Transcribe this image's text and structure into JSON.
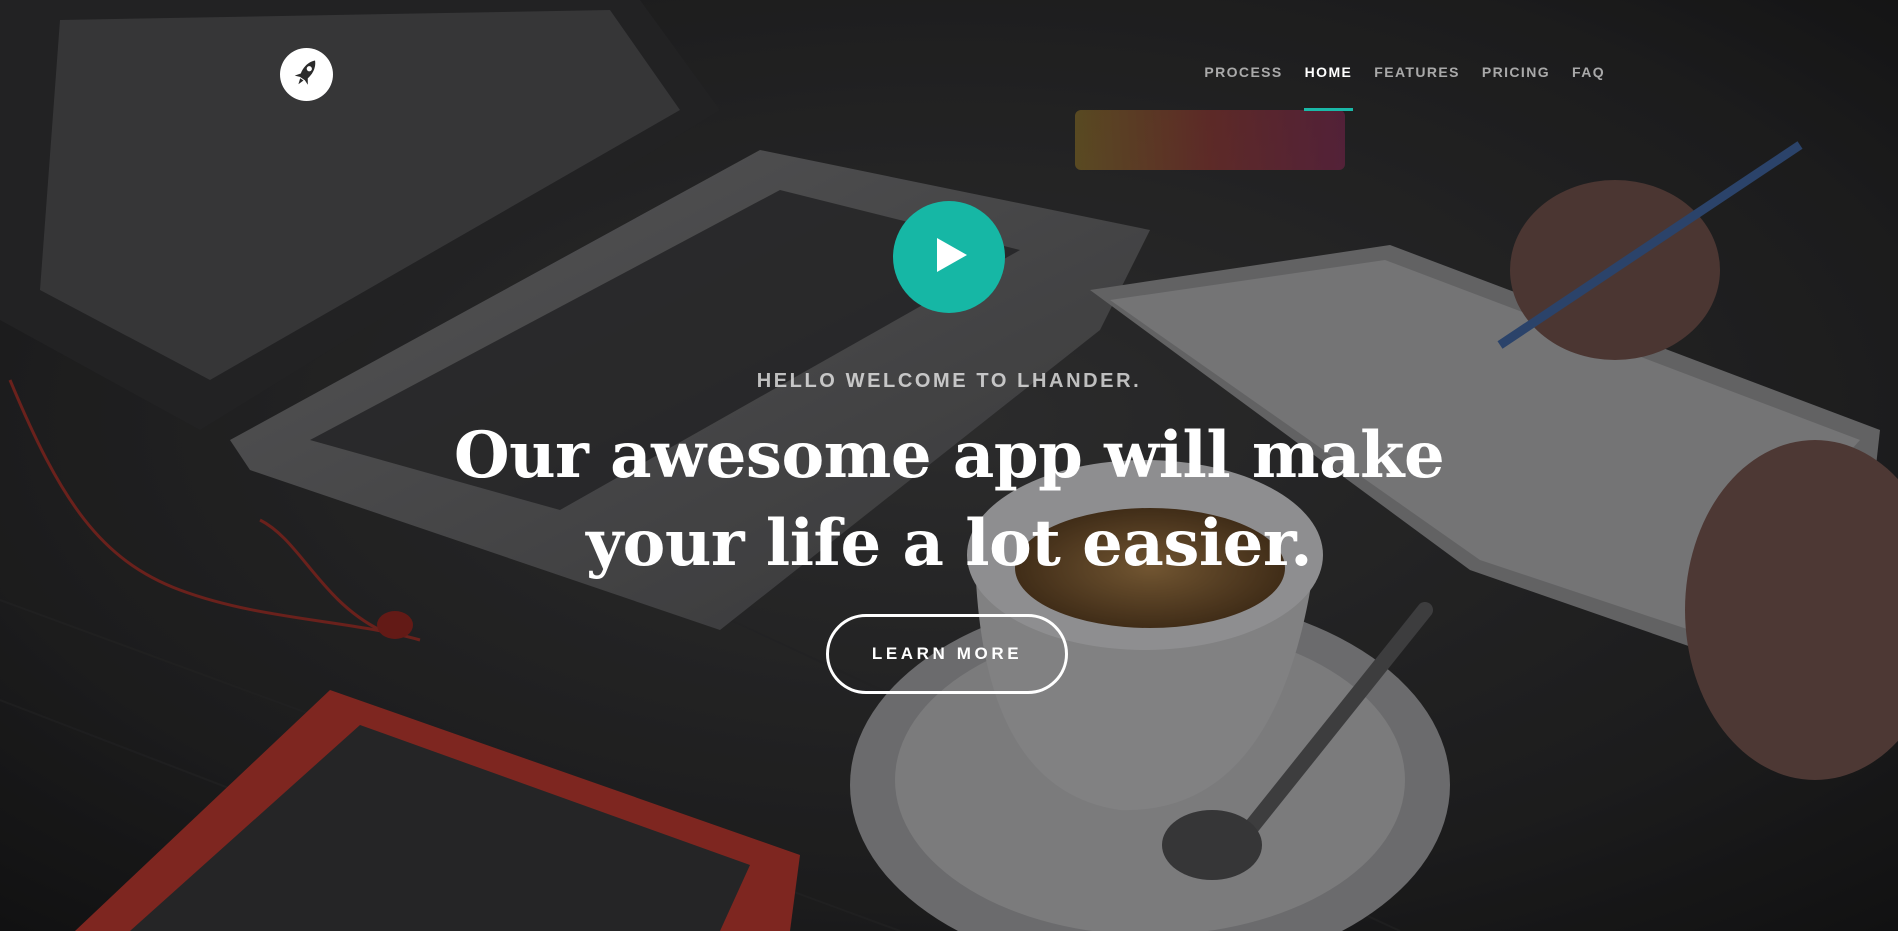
{
  "brand": {
    "logo_icon": "rocket-icon",
    "accent_color": "#16b7a5"
  },
  "nav": {
    "items": [
      {
        "label": "PROCESS",
        "active": false
      },
      {
        "label": "HOME",
        "active": true
      },
      {
        "label": "FEATURES",
        "active": false
      },
      {
        "label": "PRICING",
        "active": false
      },
      {
        "label": "FAQ",
        "active": false
      }
    ]
  },
  "hero": {
    "play_icon": "play-icon",
    "eyebrow": "HELLO WELCOME TO LHANDER.",
    "headline_line1": "Our awesome app will make",
    "headline_line2": "your life a lot easier.",
    "cta_label": "LEARN MORE",
    "background": "desk-with-laptop-coffee-notebook-photo"
  }
}
